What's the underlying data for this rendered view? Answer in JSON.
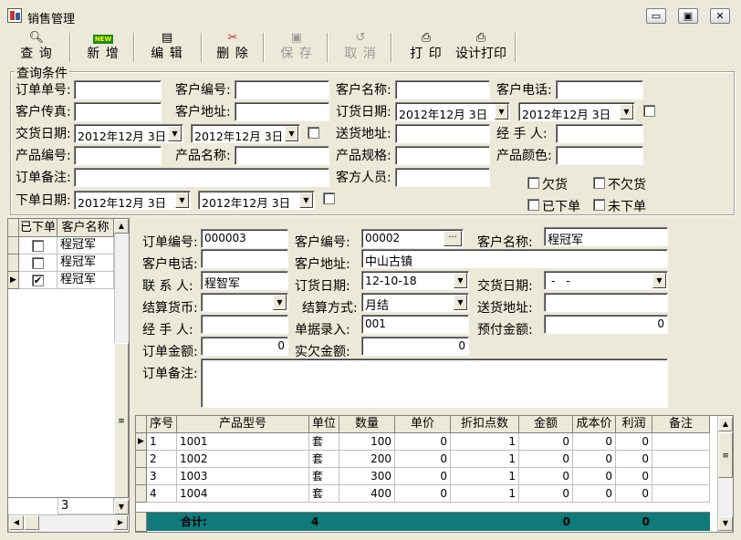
{
  "window": {
    "title": "销售管理",
    "min": "▭",
    "max": "▣",
    "close": "✕"
  },
  "toolbar": {
    "query": "查 询",
    "add": "新 增",
    "add_badge": "NEW",
    "edit": "编 辑",
    "delete": "删 除",
    "save": "保 存",
    "cancel": "取 消",
    "print": "打 印",
    "design_print": "设计打印"
  },
  "query": {
    "title": "查询条件",
    "order_no": "订单单号:",
    "cust_no": "客户编号:",
    "cust_name": "客户名称:",
    "cust_phone": "客户电话:",
    "cust_fax": "客户传真:",
    "cust_addr": "客户地址:",
    "order_date": "订货日期:",
    "order_date_from": "2012年12月 3日",
    "order_date_to": "2012年12月 3日",
    "delivery_date": "交货日期:",
    "delivery_date_from": "2012年12月 3日",
    "delivery_date_to": "2012年12月 3日",
    "ship_addr": "送货地址:",
    "handler": "经 手 人:",
    "product_no": "产品编号:",
    "product_name": "产品名称:",
    "product_spec": "产品规格:",
    "product_color": "产品颜色:",
    "order_remark": "订单备注:",
    "cust_staff": "客方人员:",
    "place_date": "下单日期:",
    "place_date_from": "2012年12月 3日",
    "place_date_to": "2012年12月 3日",
    "owed": "欠货",
    "not_owed": "不欠货",
    "placed": "已下单",
    "not_placed": "未下单"
  },
  "left_grid": {
    "col_placed": "已下单",
    "col_cust": "客户名称",
    "rows": [
      {
        "checked": "",
        "name": "程冠军"
      },
      {
        "checked": "",
        "name": "程冠军"
      },
      {
        "checked": "✔",
        "name": "程冠军"
      }
    ],
    "footer_count": "3"
  },
  "detail": {
    "order_no_label": "订单编号:",
    "order_no": "000003",
    "cust_no_label": "客户编号:",
    "cust_no": "00002",
    "cust_no_btn": "···",
    "cust_name_label": "客户名称:",
    "cust_name": "程冠军",
    "cust_phone_label": "客户电话:",
    "cust_phone": "",
    "cust_addr_label": "客户地址:",
    "cust_addr": "中山古镇",
    "contact_label": "联 系 人:",
    "contact": "程智军",
    "order_date_label": "订货日期:",
    "order_date": "12-10-18",
    "delivery_date_label": "交货日期:",
    "delivery_date": " -   -",
    "currency_label": "结算货币:",
    "currency": "",
    "settle_label": "结算方式:",
    "settle": "月结",
    "ship_addr_label": "送货地址:",
    "ship_addr": "",
    "handler_label": "经 手 人:",
    "handler": "",
    "entry_label": "单据录入:",
    "entry": "001",
    "prepay_label": "预付金额:",
    "prepay": "0",
    "amount_label": "订单金额:",
    "amount": "0",
    "owed_label": "实欠金额:",
    "owed": "0",
    "remark_label": "订单备注:",
    "remark": ""
  },
  "items_grid": {
    "headers": [
      "序号",
      "产品型号",
      "单位",
      "数量",
      "单价",
      "折扣点数",
      "金额",
      "成本价",
      "利润",
      "备注"
    ],
    "rows": [
      [
        "1",
        "1001",
        "套",
        "100",
        "0",
        "1",
        "0",
        "0",
        "0",
        ""
      ],
      [
        "2",
        "1002",
        "套",
        "200",
        "0",
        "1",
        "0",
        "0",
        "0",
        ""
      ],
      [
        "3",
        "1003",
        "套",
        "300",
        "0",
        "1",
        "0",
        "0",
        "0",
        ""
      ],
      [
        "4",
        "1004",
        "套",
        "400",
        "0",
        "1",
        "0",
        "0",
        "0",
        ""
      ]
    ],
    "sum_label": "合计:",
    "sum_qty": "4",
    "sum_amount": "0",
    "sum_profit": "0"
  }
}
